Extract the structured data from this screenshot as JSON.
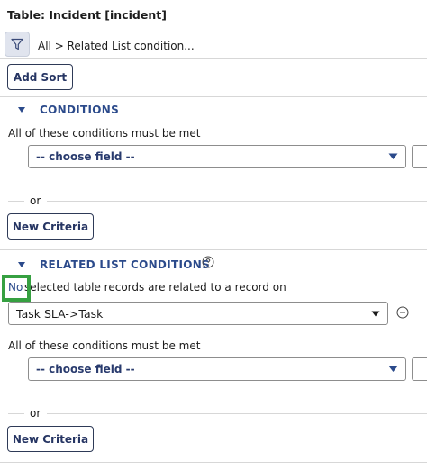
{
  "header": {
    "table_title": "Table: Incident [incident]",
    "breadcrumb": "All > Related List condition..."
  },
  "toolbar": {
    "add_sort_label": "Add Sort"
  },
  "conditions": {
    "title": "CONDITIONS",
    "label": "All of these conditions must be met",
    "field_placeholder": "-- choose field --",
    "or_label": "or",
    "new_criteria_label": "New Criteria"
  },
  "related_list": {
    "title": "RELATED LIST CONDITIONS",
    "link_text": "No",
    "description": "selected table records are related to a record on",
    "related_select_value": "Task SLA->Task",
    "label": "All of these conditions must be met",
    "field_placeholder": "-- choose field --",
    "or_label": "or",
    "new_criteria_label": "New Criteria"
  },
  "colors": {
    "accent": "#2b4a8b",
    "button_text": "#263563",
    "highlight": "#36a041"
  }
}
